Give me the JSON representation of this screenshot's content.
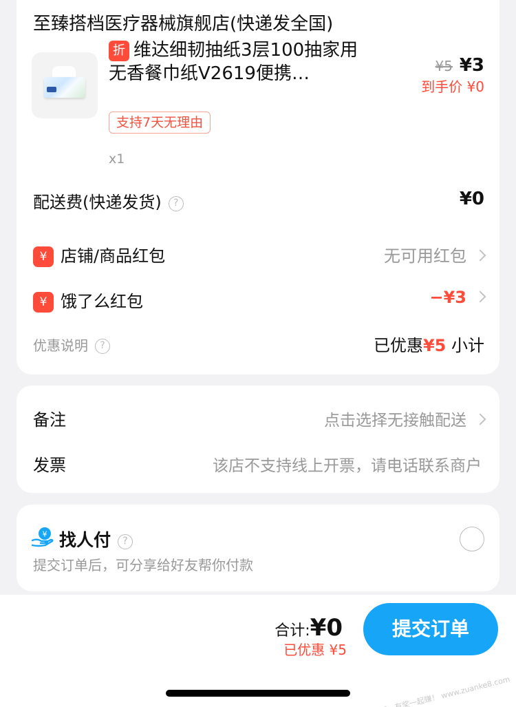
{
  "shop": {
    "name": "至臻搭档医疗器械旗舰店(快递发全国)"
  },
  "product": {
    "discount_badge": "折",
    "title": "维达细韧抽纸3层100抽家用无香餐巾纸V2619便携…",
    "original_price": "¥5",
    "price": "¥3",
    "final_price": "到手价 ¥0",
    "return_tag": "支持7天无理由",
    "quantity": "x1"
  },
  "delivery": {
    "label": "配送费(快递发货)",
    "value": "¥0",
    "help_icon": "?"
  },
  "shop_coupon": {
    "icon": "¥",
    "label": "店铺/商品红包",
    "value": "无可用红包"
  },
  "ele_coupon": {
    "icon": "¥",
    "label": "饿了么红包",
    "value": "−¥3"
  },
  "discount_summary": {
    "label": "优惠说明",
    "help_icon": "?",
    "saved_prefix": "已优惠",
    "saved_amount": "¥5",
    "subtotal_label": "小计"
  },
  "remarks": {
    "label": "备注",
    "value": "点击选择无接触配送"
  },
  "invoice": {
    "label": "发票",
    "value": "该店不支持线上开票，请电话联系商户"
  },
  "pay_for_me": {
    "title": "找人付",
    "help_icon": "?",
    "subtitle": "提交订单后，可分享给好友帮你付款"
  },
  "footer": {
    "total_label": "合计:",
    "total_value": "¥0",
    "discount": "已优惠 ¥5",
    "submit_label": "提交订单",
    "watermark": "赚客吧，有奖一起赚！ www.zuanke8.com"
  },
  "colors": {
    "accent": "#17a5f7",
    "discount_red": "#ff4b3a",
    "background": "#f2f2f4"
  }
}
